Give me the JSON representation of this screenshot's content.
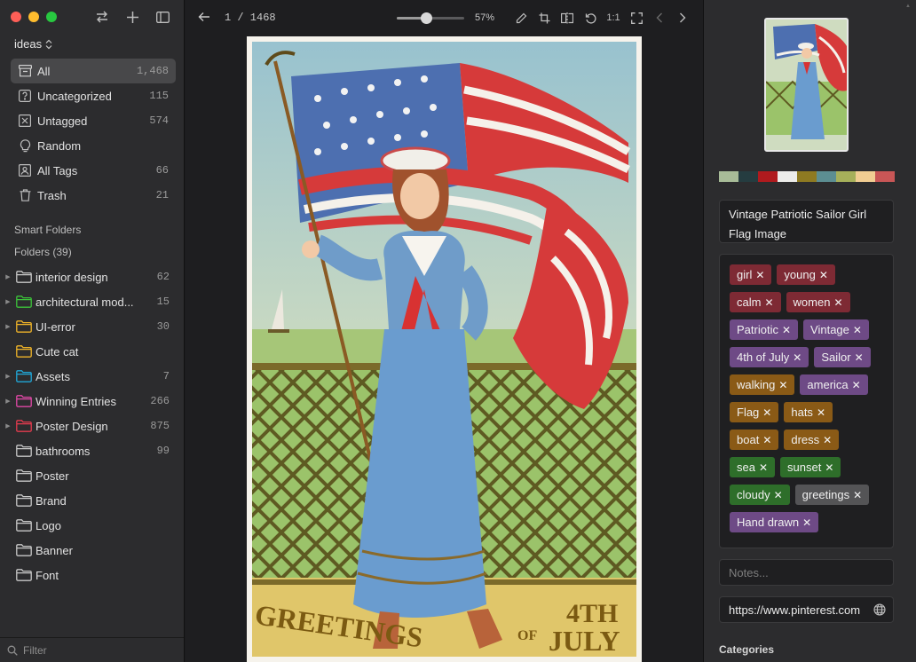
{
  "window": {
    "traffic": [
      "close",
      "minimize",
      "maximize"
    ]
  },
  "sidebar": {
    "top_icons": [
      "swap-icon",
      "plus-icon",
      "sidebar-icon"
    ],
    "library": "ideas",
    "nav": [
      {
        "label": "All",
        "count": "1,468",
        "icon": "archive-icon",
        "active": true
      },
      {
        "label": "Uncategorized",
        "count": "115",
        "icon": "question-box-icon"
      },
      {
        "label": "Untagged",
        "count": "574",
        "icon": "x-box-icon"
      },
      {
        "label": "Random",
        "icon": "lightbulb-icon"
      },
      {
        "label": "All Tags",
        "count": "66",
        "icon": "tag-box-icon"
      },
      {
        "label": "Trash",
        "count": "21",
        "icon": "trash-icon"
      }
    ],
    "smart_folders_label": "Smart Folders",
    "folders_label": "Folders (39)",
    "folders": [
      {
        "label": "interior design",
        "count": "62",
        "color": "#c8c8c8",
        "expandable": true
      },
      {
        "label": "architectural mod...",
        "count": "15",
        "color": "#3cc23a",
        "expandable": true
      },
      {
        "label": "UI-error",
        "count": "30",
        "color": "#f0b429",
        "expandable": true
      },
      {
        "label": "Cute cat",
        "count": "",
        "color": "#f0b429",
        "expandable": false
      },
      {
        "label": "Assets",
        "count": "7",
        "color": "#21a7d8",
        "expandable": true
      },
      {
        "label": "Winning Entries",
        "count": "266",
        "color": "#e048a6",
        "expandable": true
      },
      {
        "label": "Poster Design",
        "count": "875",
        "color": "#e33b4e",
        "expandable": true
      },
      {
        "label": "bathrooms",
        "count": "99",
        "color": "#c8c8c8",
        "expandable": false
      },
      {
        "label": "Poster",
        "count": "",
        "color": "#c8c8c8",
        "expandable": false
      },
      {
        "label": "Brand",
        "count": "",
        "color": "#c8c8c8",
        "expandable": false
      },
      {
        "label": "Logo",
        "count": "",
        "color": "#c8c8c8",
        "expandable": false
      },
      {
        "label": "Banner",
        "count": "",
        "color": "#c8c8c8",
        "expandable": false
      },
      {
        "label": "Font",
        "count": "",
        "color": "#c8c8c8",
        "expandable": false
      }
    ],
    "filter_placeholder": "Filter"
  },
  "viewer": {
    "page": "1 / 1468",
    "zoom_fraction": 0.43,
    "zoom_label": "57%",
    "tools": [
      "pencil-icon",
      "crop-icon",
      "flip-icon",
      "rotate-icon",
      "actual-size-label",
      "fullscreen-icon",
      "prev-icon",
      "next-icon"
    ],
    "actual_size_text": "1:1",
    "postcard": {
      "greeting_text": "GREETINGS",
      "holiday_text": "4TH",
      "of_text": "OF",
      "month_text": "JULY"
    }
  },
  "inspector": {
    "palette": [
      "#a8bc98",
      "#253c40",
      "#b01a1e",
      "#ececea",
      "#8e7a22",
      "#5c8e92",
      "#a6b05a",
      "#f1cd92",
      "#c85656"
    ],
    "title": "Vintage Patriotic Sailor Girl Flag Image",
    "tags": [
      {
        "label": "girl",
        "color": "#7e2a34"
      },
      {
        "label": "young",
        "color": "#7e2a34"
      },
      {
        "label": "calm",
        "color": "#7e2a34"
      },
      {
        "label": "women",
        "color": "#7e2a34"
      },
      {
        "label": "Patriotic",
        "color": "#6e4a86"
      },
      {
        "label": "Vintage",
        "color": "#6e4a86"
      },
      {
        "label": "4th of July",
        "color": "#6e4a86"
      },
      {
        "label": "Sailor",
        "color": "#6e4a86"
      },
      {
        "label": "walking",
        "color": "#8a5a16"
      },
      {
        "label": "america",
        "color": "#6e4a86"
      },
      {
        "label": "Flag",
        "color": "#8a5a16"
      },
      {
        "label": "hats",
        "color": "#8a5a16"
      },
      {
        "label": "boat",
        "color": "#8a5a16"
      },
      {
        "label": "dress",
        "color": "#8a5a16"
      },
      {
        "label": "sea",
        "color": "#2e6e2a"
      },
      {
        "label": "sunset",
        "color": "#2e6e2a"
      },
      {
        "label": "cloudy",
        "color": "#2e6e2a"
      },
      {
        "label": "greetings",
        "color": "#545456"
      },
      {
        "label": "Hand drawn",
        "color": "#6e4a86"
      }
    ],
    "notes_placeholder": "Notes...",
    "url": "https://www.pinterest.com",
    "categories_label": "Categories"
  }
}
